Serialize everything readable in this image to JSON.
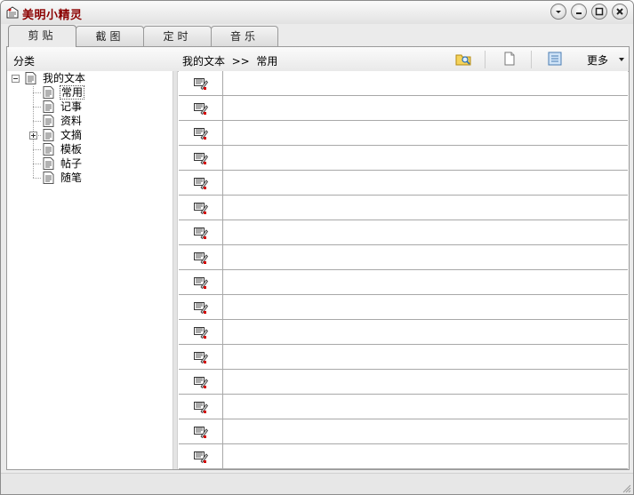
{
  "window": {
    "title": "美明小精灵",
    "controls": [
      {
        "name": "menu-button",
        "icon": "chevron-down-icon"
      },
      {
        "name": "minimize-button",
        "icon": "minimize-icon"
      },
      {
        "name": "maximize-button",
        "icon": "maximize-icon"
      },
      {
        "name": "close-button",
        "icon": "close-icon"
      }
    ]
  },
  "tabs": [
    {
      "label": "剪贴",
      "active": true
    },
    {
      "label": "截图",
      "active": false
    },
    {
      "label": "定时",
      "active": false
    },
    {
      "label": "音乐",
      "active": false
    }
  ],
  "header": {
    "category_label": "分类",
    "breadcrumb": "我的文本  >>  常用",
    "toolbar": {
      "search_icon": "folder-search-icon",
      "new_icon": "new-document-icon",
      "notes_icon": "notes-icon",
      "more_label": "更多"
    }
  },
  "tree": {
    "root": {
      "label": "我的文本",
      "expanded": true
    },
    "children": [
      {
        "label": "常用",
        "selected": true,
        "expandable": false
      },
      {
        "label": "记事",
        "selected": false,
        "expandable": false
      },
      {
        "label": "资料",
        "selected": false,
        "expandable": false
      },
      {
        "label": "文摘",
        "selected": false,
        "expandable": true
      },
      {
        "label": "模板",
        "selected": false,
        "expandable": false
      },
      {
        "label": "帖子",
        "selected": false,
        "expandable": false
      },
      {
        "label": "随笔",
        "selected": false,
        "expandable": false
      }
    ]
  },
  "list": {
    "row_count": 16,
    "row_icon": "clip-edit-icon",
    "rows": [
      "",
      "",
      "",
      "",
      "",
      "",
      "",
      "",
      "",
      "",
      "",
      "",
      "",
      "",
      "",
      ""
    ]
  },
  "colors": {
    "title_text": "#8b0000",
    "grid_line": "#a8a8a8",
    "window_bg": "#ebebeb"
  }
}
